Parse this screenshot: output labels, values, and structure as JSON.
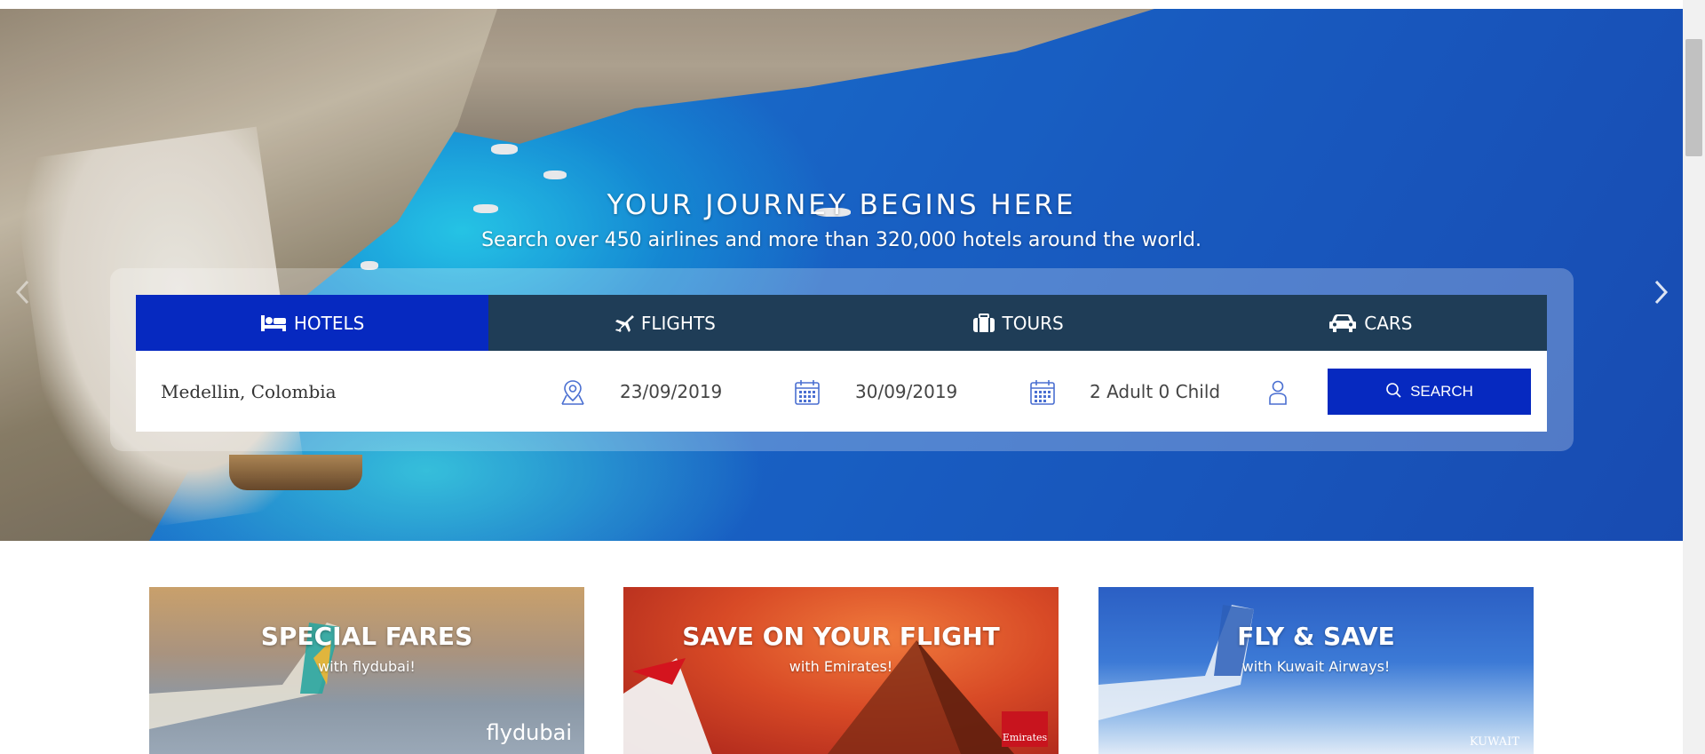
{
  "hero": {
    "title": "YOUR JOURNEY BEGINS HERE",
    "subtitle": "Search over 450 airlines and more than 320,000 hotels around the world."
  },
  "tabs": [
    {
      "label": "HOTELS",
      "icon": "bed-icon",
      "active": true
    },
    {
      "label": "FLIGHTS",
      "icon": "airplane-icon",
      "active": false
    },
    {
      "label": "TOURS",
      "icon": "suitcase-icon",
      "active": false
    },
    {
      "label": "CARS",
      "icon": "car-icon",
      "active": false
    }
  ],
  "search": {
    "location_value": "Medellin, Colombia",
    "checkin_value": "23/09/2019",
    "checkout_value": "30/09/2019",
    "guests_value": "2 Adult 0 Child",
    "button_label": "SEARCH"
  },
  "promos": [
    {
      "title": "SPECIAL FARES",
      "subtitle": "with flydubai!",
      "logo": "flydubai"
    },
    {
      "title": "SAVE ON YOUR FLIGHT",
      "subtitle": "with Emirates!",
      "logo": "Emirates"
    },
    {
      "title": "FLY & SAVE",
      "subtitle": "with Kuwait Airways!",
      "logo": "KUWAIT"
    }
  ],
  "colors": {
    "accent": "#0629c0",
    "tab_bar": "#1f3d57"
  }
}
